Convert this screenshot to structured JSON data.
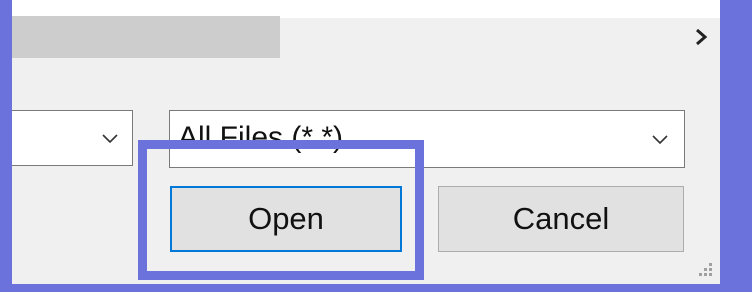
{
  "file_dialog": {
    "file_type_filter": {
      "selected": "All Files (*.*)"
    },
    "buttons": {
      "open_label": "Open",
      "cancel_label": "Cancel"
    }
  },
  "colors": {
    "highlight": "#6b72dc",
    "focus_border": "#0078d7",
    "dialog_bg": "#f0f0f0"
  },
  "icons": {
    "scroll_right": "chevron-right-icon",
    "dropdown": "chevron-down-icon",
    "resize": "resize-grip-icon"
  }
}
